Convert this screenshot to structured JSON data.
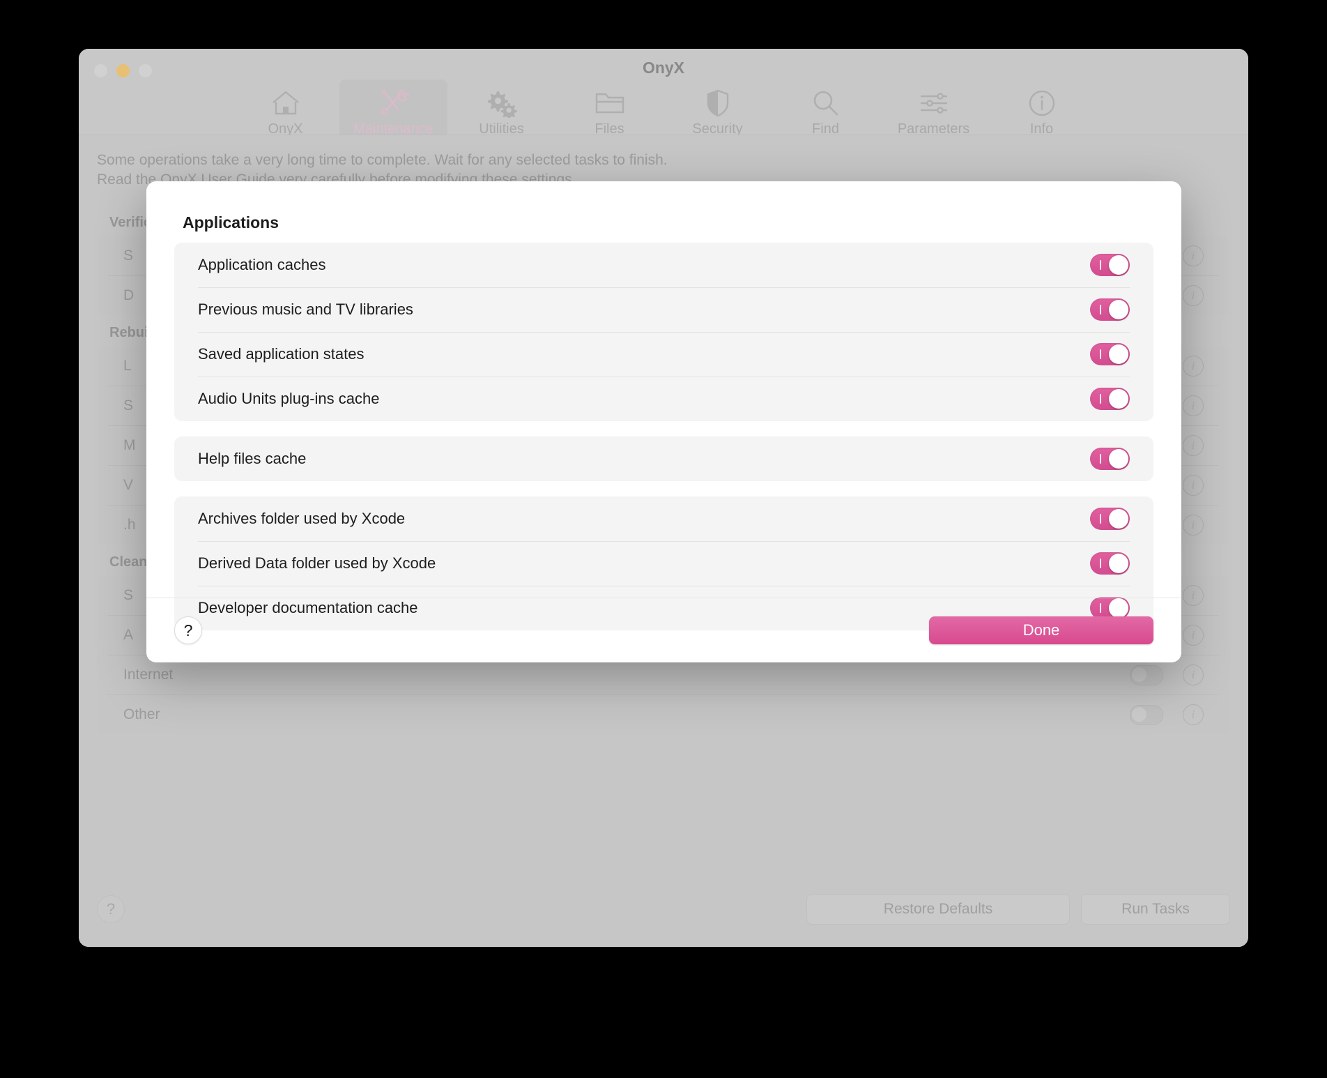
{
  "window": {
    "title": "OnyX",
    "traffic_lights": [
      "close",
      "minimize",
      "zoom"
    ],
    "toolbar": [
      {
        "label": "OnyX",
        "icon": "home-icon",
        "active": false
      },
      {
        "label": "Maintenance",
        "icon": "tools-icon",
        "active": true
      },
      {
        "label": "Utilities",
        "icon": "gears-icon",
        "active": false
      },
      {
        "label": "Files",
        "icon": "folder-icon",
        "active": false
      },
      {
        "label": "Security",
        "icon": "shield-icon",
        "active": false
      },
      {
        "label": "Find",
        "icon": "magnifier-icon",
        "active": false
      },
      {
        "label": "Parameters",
        "icon": "sliders-icon",
        "active": false
      },
      {
        "label": "Info",
        "icon": "info-circle-icon",
        "active": false
      }
    ],
    "intro_line1": "Some operations take a very long time to complete. Wait for any selected tasks to finish.",
    "intro_line2": "Read the OnyX User Guide very carefully before modifying these settings.",
    "groups": [
      {
        "title": "Verification",
        "rows": [
          {
            "label": "S",
            "toggle": false
          },
          {
            "label": "D",
            "toggle": false
          }
        ]
      },
      {
        "title": "Rebuilding",
        "rows": [
          {
            "label": "L",
            "toggle": false
          },
          {
            "label": "S",
            "toggle": false
          },
          {
            "label": "M",
            "toggle": false
          },
          {
            "label": "V",
            "toggle": false
          },
          {
            "label": ".h",
            "toggle": false
          }
        ]
      },
      {
        "title": "Cleaning",
        "rows": [
          {
            "label": "S",
            "toggle": false
          },
          {
            "label": "A",
            "toggle": false
          },
          {
            "label": "Internet",
            "toggle": false
          },
          {
            "label": "Other",
            "toggle": false
          }
        ]
      }
    ],
    "footer": {
      "help_label": "?",
      "restore_defaults_label": "Restore Defaults",
      "run_tasks_label": "Run Tasks"
    }
  },
  "dialog": {
    "title": "Applications",
    "sections": [
      {
        "name": "app-caches-section",
        "rows": [
          {
            "label": "Application caches",
            "toggle": true
          },
          {
            "label": "Previous music and TV libraries",
            "toggle": true
          },
          {
            "label": "Saved application states",
            "toggle": true
          },
          {
            "label": "Audio Units plug-ins cache",
            "toggle": true
          }
        ]
      },
      {
        "name": "help-section",
        "rows": [
          {
            "label": "Help files cache",
            "toggle": true
          }
        ]
      },
      {
        "name": "xcode-section",
        "rows": [
          {
            "label": "Archives folder used by Xcode",
            "toggle": true
          },
          {
            "label": "Derived Data folder used by Xcode",
            "toggle": true
          },
          {
            "label": "Developer documentation cache",
            "toggle": true
          }
        ]
      }
    ],
    "help_label": "?",
    "done_label": "Done"
  },
  "colors": {
    "accent_pink": "#d8498f",
    "toggle_on": "#dd5a9b",
    "window_chrome": "#c6c6c6",
    "card_bg": "#f4f4f4",
    "amber_traffic_light": "#f5bd4f"
  }
}
